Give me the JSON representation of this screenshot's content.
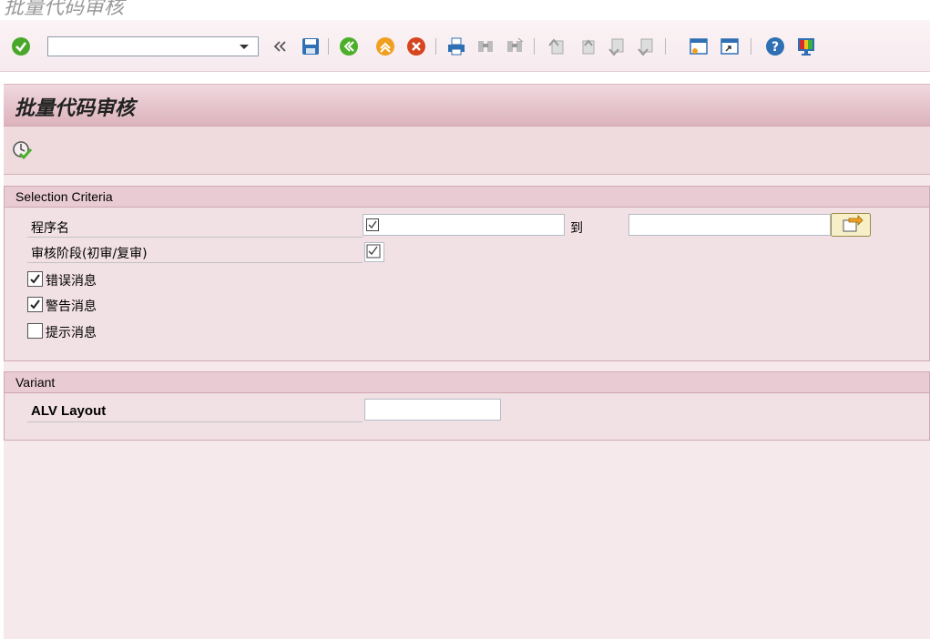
{
  "window": {
    "title": "批量代码审核"
  },
  "toolbar": {
    "command_field_value": "",
    "icons": [
      "check-icon",
      "command-dropdown-icon",
      "collapse-icon",
      "save-icon",
      "back-icon",
      "exit-icon",
      "cancel-icon",
      "print-icon",
      "find-icon",
      "find-next-icon",
      "first-page-icon",
      "previous-page-icon",
      "next-page-icon",
      "last-page-icon",
      "new-session-icon",
      "shortcut-icon",
      "help-icon",
      "customize-layout-icon"
    ]
  },
  "header": {
    "title": "批量代码审核"
  },
  "app_toolbar": {
    "icons": [
      "execute-icon"
    ]
  },
  "selection": {
    "title": "Selection Criteria",
    "program_label": "程序名",
    "program_from": "",
    "to_label": "到",
    "program_to": "",
    "stage_label": "审核阶段(初审/复审)",
    "stage_checked": true,
    "checkboxes": [
      {
        "label": "错误消息",
        "checked": true
      },
      {
        "label": "警告消息",
        "checked": true
      },
      {
        "label": "提示消息",
        "checked": false
      }
    ]
  },
  "variant": {
    "title": "Variant",
    "alv_label": "ALV Layout",
    "alv_value": ""
  },
  "colors": {
    "header": "#dcb3bd",
    "background": "#f5e9ec",
    "accent_green": "#4caf2a",
    "accent_orange": "#f0a020"
  }
}
